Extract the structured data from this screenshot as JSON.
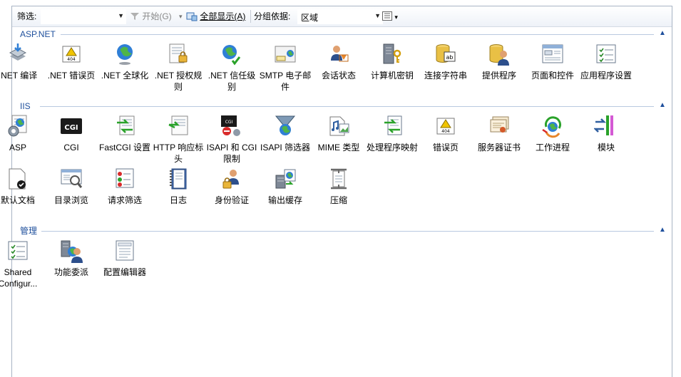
{
  "toolbar": {
    "filter_label": "筛选:",
    "filter_value": "",
    "start_label": "开始(G)",
    "showall_label": "全部显示(A)",
    "groupby_label": "分组依据:",
    "groupby_value": "区域"
  },
  "sections": [
    {
      "title": "ASP.NET",
      "items": [
        {
          "label": ".NET 编译",
          "icon": "dotnet-compilation-icon"
        },
        {
          "label": ".NET 错误页",
          "icon": "dotnet-error-pages-icon"
        },
        {
          "label": ".NET 全球化",
          "icon": "dotnet-globalization-icon"
        },
        {
          "label": ".NET 授权规则",
          "icon": "dotnet-authorization-rules-icon"
        },
        {
          "label": ".NET 信任级别",
          "icon": "dotnet-trust-levels-icon"
        },
        {
          "label": "SMTP 电子邮件",
          "icon": "smtp-email-icon"
        },
        {
          "label": "会话状态",
          "icon": "session-state-icon"
        },
        {
          "label": "计算机密钥",
          "icon": "machine-key-icon"
        },
        {
          "label": "连接字符串",
          "icon": "connection-strings-icon"
        },
        {
          "label": "提供程序",
          "icon": "providers-icon"
        },
        {
          "label": "页面和控件",
          "icon": "pages-controls-icon"
        },
        {
          "label": "应用程序设置",
          "icon": "application-settings-icon"
        }
      ]
    },
    {
      "title": "IIS",
      "items": [
        {
          "label": "ASP",
          "icon": "asp-icon"
        },
        {
          "label": "CGI",
          "icon": "cgi-icon"
        },
        {
          "label": "FastCGI 设置",
          "icon": "fastcgi-settings-icon"
        },
        {
          "label": "HTTP 响应标头",
          "icon": "http-response-headers-icon"
        },
        {
          "label": "ISAPI 和 CGI 限制",
          "icon": "isapi-cgi-restrictions-icon"
        },
        {
          "label": "ISAPI 筛选器",
          "icon": "isapi-filters-icon"
        },
        {
          "label": "MIME 类型",
          "icon": "mime-types-icon"
        },
        {
          "label": "处理程序映射",
          "icon": "handler-mappings-icon"
        },
        {
          "label": "错误页",
          "icon": "error-pages-icon"
        },
        {
          "label": "服务器证书",
          "icon": "server-certificates-icon"
        },
        {
          "label": "工作进程",
          "icon": "worker-processes-icon"
        },
        {
          "label": "模块",
          "icon": "modules-icon"
        },
        {
          "label": "默认文档",
          "icon": "default-document-icon"
        },
        {
          "label": "目录浏览",
          "icon": "directory-browsing-icon"
        },
        {
          "label": "请求筛选",
          "icon": "request-filtering-icon"
        },
        {
          "label": "日志",
          "icon": "logging-icon"
        },
        {
          "label": "身份验证",
          "icon": "authentication-icon"
        },
        {
          "label": "输出缓存",
          "icon": "output-caching-icon"
        },
        {
          "label": "压缩",
          "icon": "compression-icon"
        }
      ]
    },
    {
      "title": "管理",
      "items": [
        {
          "label": "Shared Configur...",
          "icon": "shared-configuration-icon"
        },
        {
          "label": "功能委派",
          "icon": "feature-delegation-icon"
        },
        {
          "label": "配置编辑器",
          "icon": "configuration-editor-icon"
        }
      ]
    }
  ]
}
